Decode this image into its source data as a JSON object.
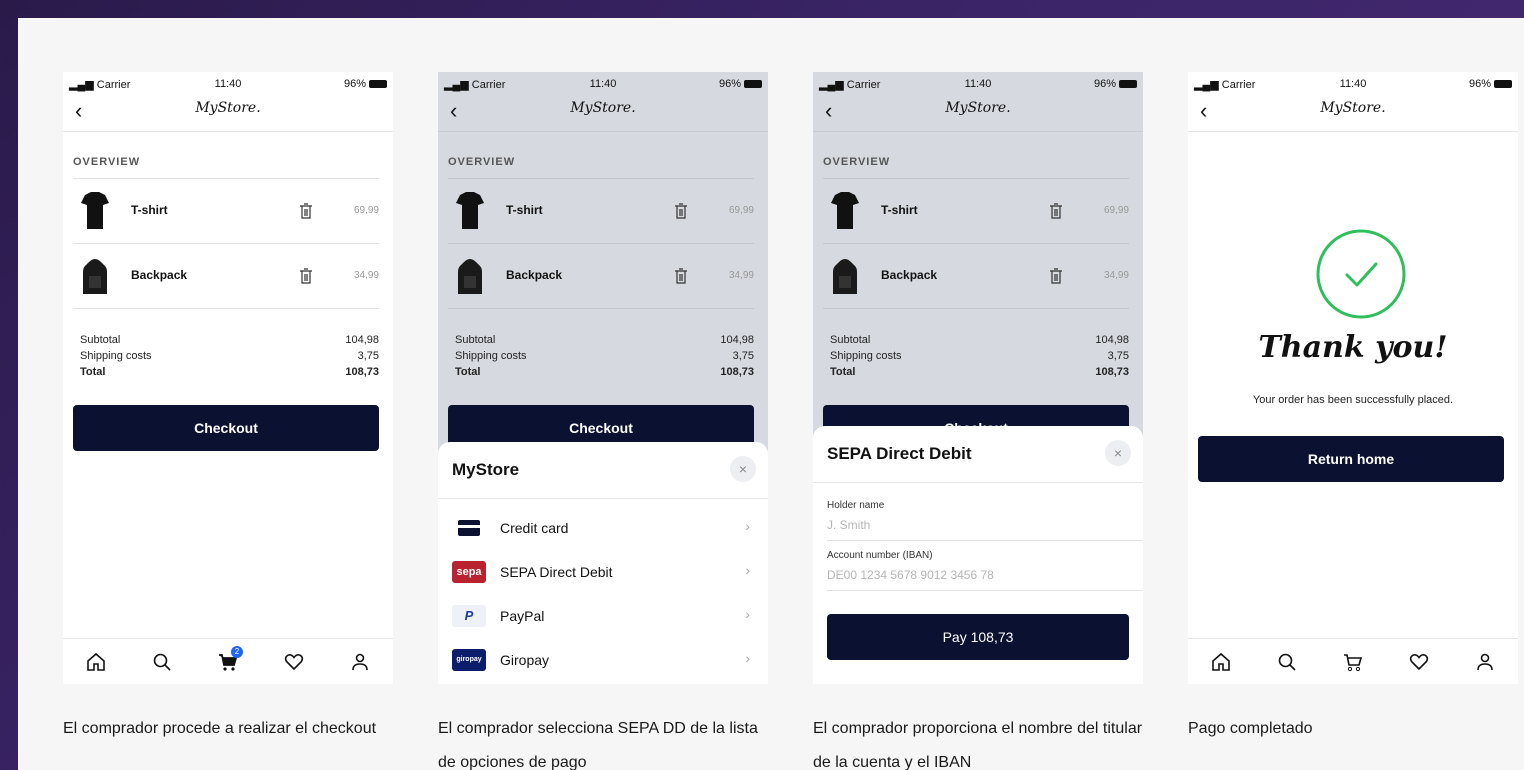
{
  "status": {
    "carrier": "Carrier",
    "time": "11:40",
    "battery": "96%"
  },
  "navbar": {
    "logo": "MyStore."
  },
  "cart": {
    "overview_label": "OVERVIEW",
    "items": [
      {
        "name": "T-shirt",
        "price": "69,99",
        "icon": "tshirt-icon"
      },
      {
        "name": "Backpack",
        "price": "34,99",
        "icon": "backpack-icon"
      }
    ],
    "subtotal_label": "Subtotal",
    "subtotal": "104,98",
    "shipping_label": "Shipping costs",
    "shipping": "3,75",
    "total_label": "Total",
    "total": "108,73",
    "checkout_label": "Checkout",
    "checkout_partial": "Checkout",
    "cart_badge": "2"
  },
  "payment_sheet": {
    "title": "MyStore",
    "close": "×",
    "options": [
      {
        "label": "Credit card",
        "icon": "credit-card-icon",
        "chevron": "›"
      },
      {
        "label": "SEPA Direct Debit",
        "icon": "sepa-icon",
        "icon_text": "sepa",
        "chevron": "›"
      },
      {
        "label": "PayPal",
        "icon": "paypal-icon",
        "icon_text": "P",
        "chevron": "›"
      },
      {
        "label": "Giropay",
        "icon": "giropay-icon",
        "icon_text": "giropay",
        "chevron": "›"
      }
    ]
  },
  "sepa_sheet": {
    "title": "SEPA Direct Debit",
    "close": "×",
    "holder_label": "Holder name",
    "holder_placeholder": "J. Smith",
    "iban_label": "Account number (IBAN)",
    "iban_placeholder": "DE00 1234 5678 9012 3456 78",
    "pay_button": "Pay 108,73"
  },
  "success": {
    "title": "Thank you!",
    "subtitle": "Your order has been successfully placed.",
    "button": "Return home"
  },
  "captions": [
    "El comprador procede a realizar el checkout",
    "El comprador selecciona SEPA DD de la lista de opciones de pago",
    "El comprador proporciona el nombre del titular de la cuenta y el IBAN",
    "Pago completado"
  ],
  "colors": {
    "button_dark": "#0b1130",
    "success_green": "#2fbf5a",
    "sepa_red": "#b8232f",
    "badge_blue": "#1e66f5"
  }
}
